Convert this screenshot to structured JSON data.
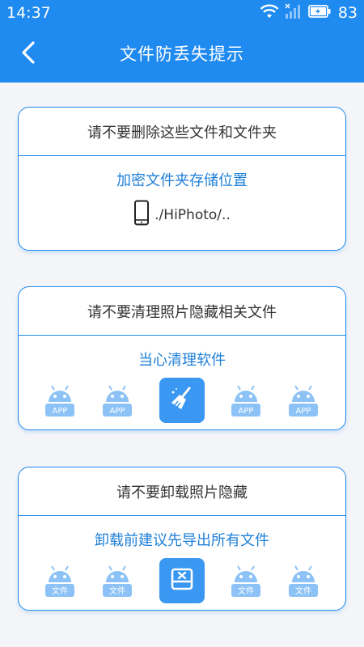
{
  "status_bar": {
    "time": "14:37",
    "battery": "83",
    "icons": [
      "wifi-icon",
      "signal-icon",
      "battery-charging-icon"
    ]
  },
  "header": {
    "title": "文件防丢失提示",
    "back_icon": "chevron-left-icon"
  },
  "colors": {
    "primary": "#1f8af0",
    "accent_text": "#1f80d8",
    "icon_light": "#8cc2f6"
  },
  "cards": [
    {
      "heading": "请不要删除这些文件和文件夹",
      "subtitle": "加密文件夹存储位置",
      "path": "./HiPhoto/..",
      "icon": "phone-icon"
    },
    {
      "heading": "请不要清理照片隐藏相关文件",
      "subtitle": "当心清理软件",
      "app_label": "APP",
      "center_icon": "broom-icon"
    },
    {
      "heading": "请不要卸载照片隐藏",
      "subtitle": "卸载前建议先导出所有文件",
      "app_label": "文件",
      "center_icon": "uninstall-icon"
    }
  ]
}
